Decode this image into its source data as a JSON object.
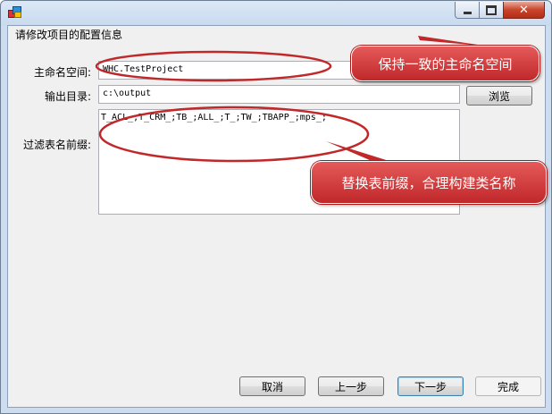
{
  "window": {
    "title": "",
    "controls": {
      "minimize_icon": "minimize-icon",
      "maximize_icon": "maximize-icon",
      "close_icon": "close-icon",
      "close_glyph": "✕"
    }
  },
  "form": {
    "section_title": "请修改项目的配置信息",
    "namespace": {
      "label": "主命名空间:",
      "value": "WHC.TestProject"
    },
    "output_dir": {
      "label": "输出目录:",
      "value": "c:\\output",
      "browse_label": "浏览"
    },
    "filter_prefix": {
      "label": "过滤表名前缀:",
      "value": "T_ACL_;T_CRM_;TB_;ALL_;T_;TW_;TBAPP_;mps_;"
    }
  },
  "buttons": {
    "cancel": "取消",
    "prev": "上一步",
    "next": "下一步",
    "finish": "完成"
  },
  "annotations": {
    "callout_namespace": "保持一致的主命名空间",
    "callout_prefix": "替换表前缀，合理构建类名称"
  },
  "colors": {
    "annotation_red": "#c0282a",
    "titlebar": "#c9daee",
    "client_bg": "#f0f0f0"
  }
}
